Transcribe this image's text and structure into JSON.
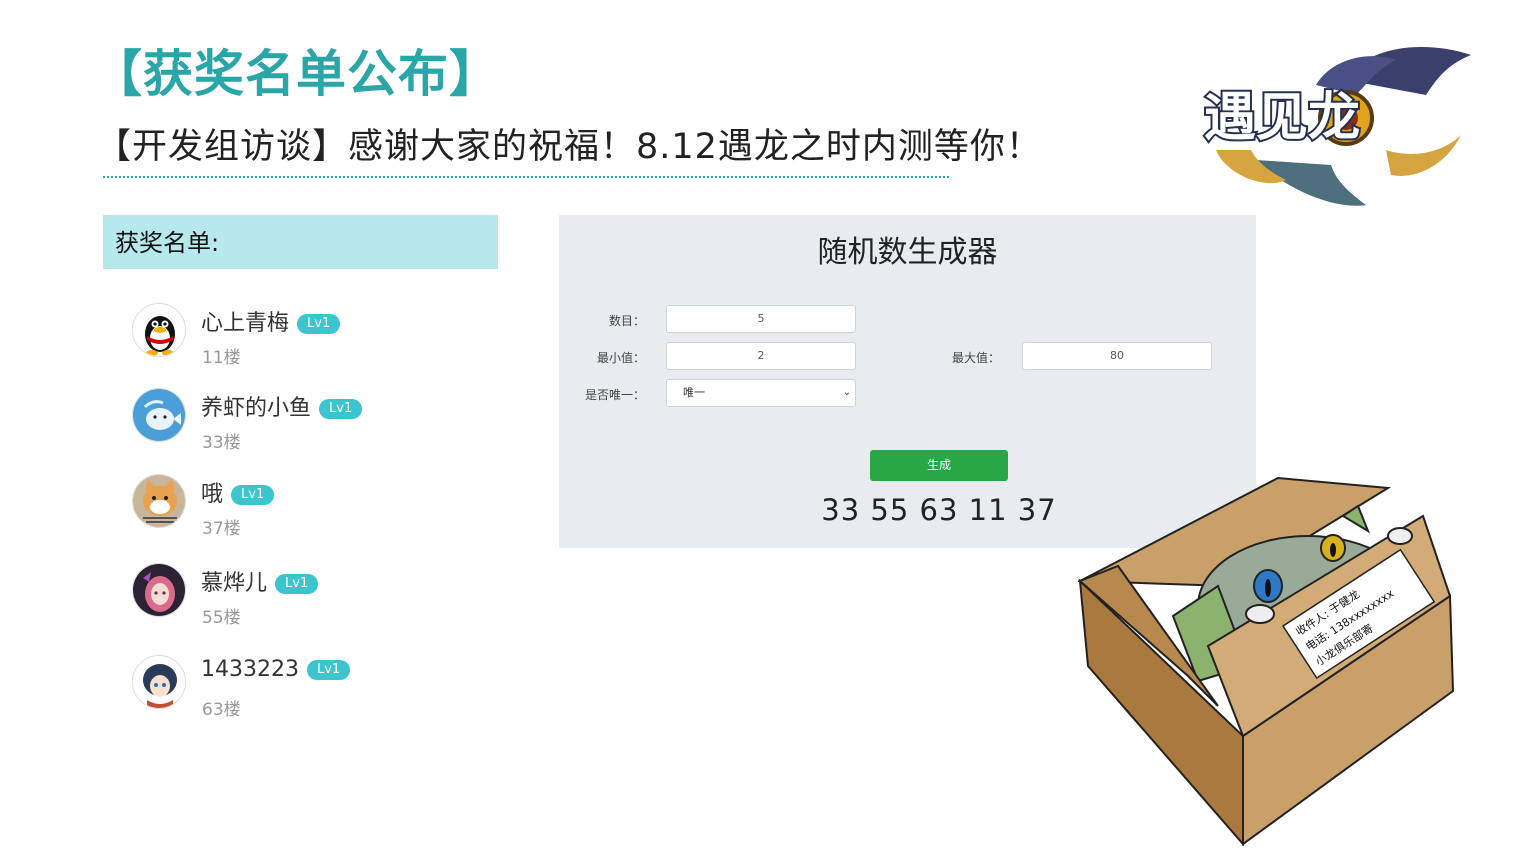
{
  "page": {
    "title": "【获奖名单公布】",
    "subtitle": "【开发组访谈】感谢大家的祝福！8.12遇龙之时内测等你！"
  },
  "logo": {
    "text": "遇见龙"
  },
  "winners": {
    "header": "获奖名单:",
    "items": [
      {
        "name": "心上青梅",
        "level": "Lv1",
        "floor": "11楼",
        "avatar": "qq-penguin-avatar"
      },
      {
        "name": "养虾的小鱼",
        "level": "Lv1",
        "floor": "33楼",
        "avatar": "blue-fish-avatar"
      },
      {
        "name": "哦",
        "level": "Lv1",
        "floor": "37楼",
        "avatar": "cat-avatar"
      },
      {
        "name": "慕烨儿",
        "level": "Lv1",
        "floor": "55楼",
        "avatar": "anime-pink-girl-avatar"
      },
      {
        "name": "1433223",
        "level": "Lv1",
        "floor": "63楼",
        "avatar": "anime-girl-avatar"
      }
    ]
  },
  "generator": {
    "title": "随机数生成器",
    "count_label": "数目：",
    "count_value": "5",
    "min_label": "最小值：",
    "min_value": "2",
    "max_label": "最大值：",
    "max_value": "80",
    "unique_label": "是否唯一：",
    "unique_value": "唯一",
    "button_label": "生成",
    "result": "33 55 63 11 37"
  },
  "parcel": {
    "line1": "收件人: 于健龙",
    "line2": "电话: 138xxxxxxxx",
    "line3": "小龙俱乐部寄"
  },
  "colors": {
    "accent": "#2aa5a8",
    "header_bg": "#b7e8ec",
    "button": "#28a745",
    "panel_bg": "#e9ecef"
  }
}
